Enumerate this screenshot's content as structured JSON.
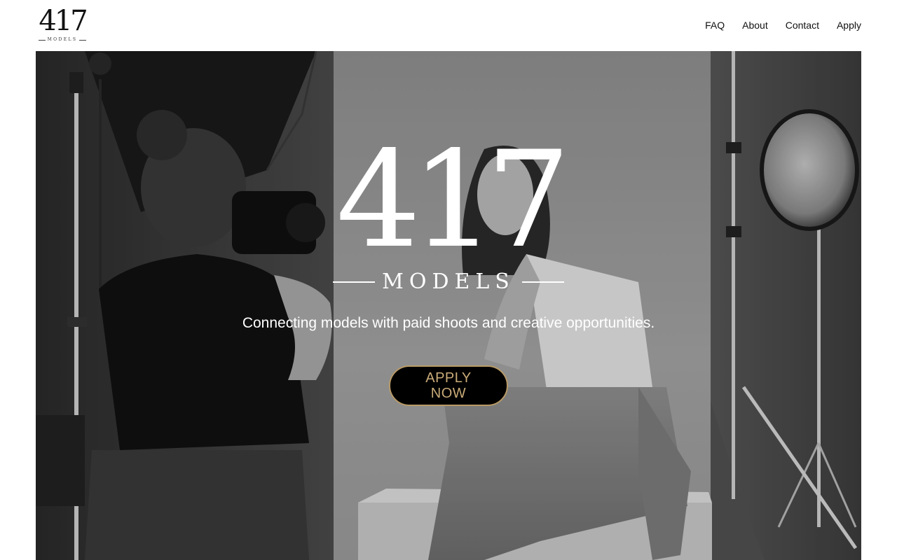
{
  "header": {
    "brand": {
      "number": "417",
      "sub": "MODELS"
    },
    "nav": [
      {
        "label": "FAQ"
      },
      {
        "label": "About"
      },
      {
        "label": "Contact"
      },
      {
        "label": "Apply"
      }
    ]
  },
  "hero": {
    "logo": {
      "number": "417",
      "sub": "MODELS"
    },
    "tagline": "Connecting models with paid shoots and creative opportunities.",
    "cta_label": "APPLY NOW"
  },
  "colors": {
    "accent_gold": "#b89a67",
    "cta_background": "#000000",
    "header_background": "#ffffff"
  }
}
